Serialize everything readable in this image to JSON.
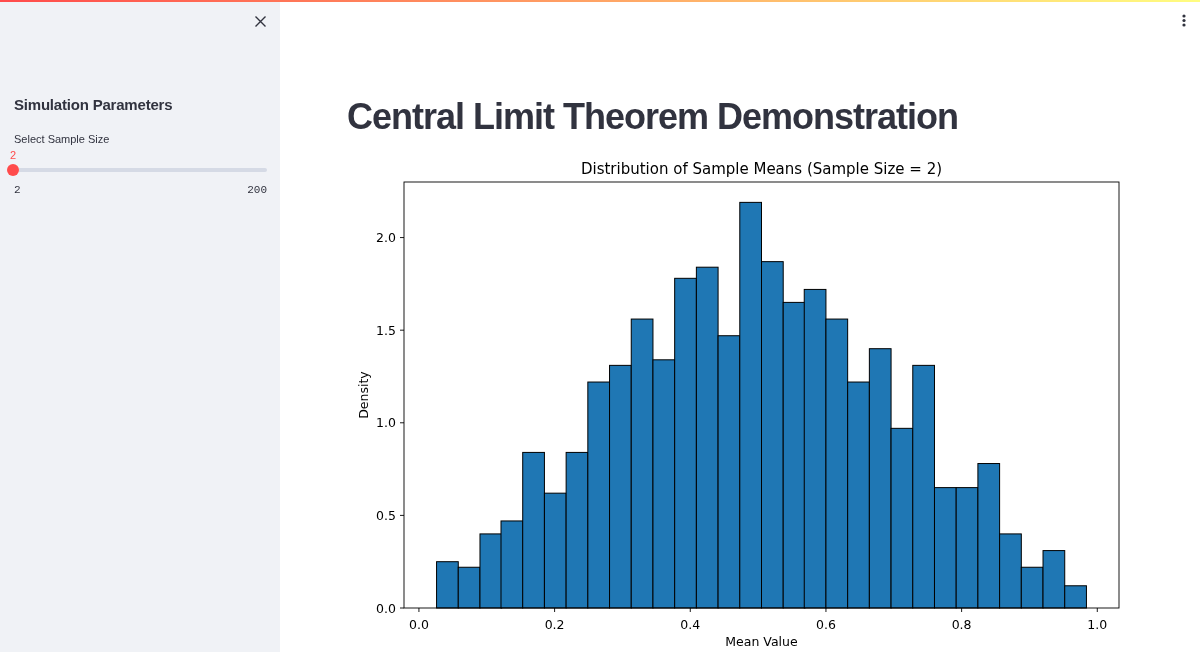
{
  "sidebar": {
    "heading": "Simulation Parameters",
    "slider": {
      "label": "Select Sample Size",
      "value": "2",
      "min": "2",
      "max": "200",
      "level": 0
    }
  },
  "main": {
    "title": "Central Limit Theorem Demonstration",
    "chart": {
      "chart_data": {
        "type": "bar",
        "title": "Distribution of Sample Means (Sample Size = 2)",
        "xlabel": "Mean Value",
        "ylabel": "Density",
        "x": [
          0.042,
          0.074,
          0.106,
          0.137,
          0.169,
          0.201,
          0.233,
          0.265,
          0.297,
          0.329,
          0.361,
          0.393,
          0.425,
          0.457,
          0.489,
          0.521,
          0.553,
          0.584,
          0.616,
          0.648,
          0.68,
          0.712,
          0.744,
          0.776,
          0.808,
          0.84,
          0.872,
          0.904,
          0.936,
          0.968
        ],
        "values": [
          0.25,
          0.22,
          0.4,
          0.47,
          0.84,
          0.62,
          0.84,
          1.22,
          1.31,
          1.56,
          1.34,
          1.78,
          1.84,
          1.47,
          2.19,
          1.87,
          1.65,
          1.72,
          1.56,
          1.22,
          1.4,
          0.97,
          1.31,
          0.65,
          0.65,
          0.78,
          0.4,
          0.22,
          0.31,
          0.12
        ],
        "xlim": [
          -0.022,
          1.032
        ],
        "ylim": [
          0,
          2.3
        ],
        "xticks": [
          {
            "value": 0,
            "label": "0.0"
          },
          0.2,
          0.4,
          0.6,
          0.8,
          {
            "value": 1,
            "label": "1.0"
          }
        ],
        "yticks": [
          {
            "value": 0,
            "label": "0.0"
          },
          0.5,
          {
            "value": 1,
            "label": "1.0"
          },
          1.5,
          {
            "value": 2,
            "label": "2.0"
          }
        ]
      }
    }
  }
}
